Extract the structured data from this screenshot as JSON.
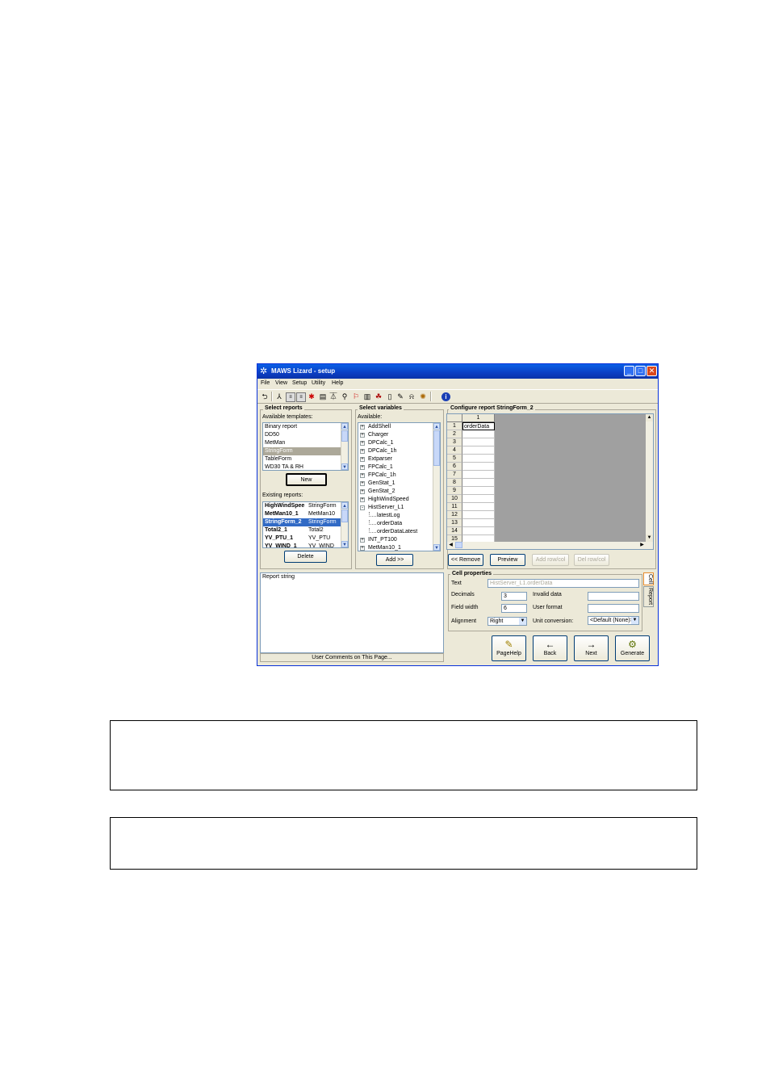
{
  "window": {
    "title": "MAWS Lizard - setup",
    "controls": [
      "minimize",
      "maximize",
      "close"
    ]
  },
  "menu": [
    "File",
    "View",
    "Setup",
    "Utility",
    "Help"
  ],
  "toolbar_icons": [
    "undo-icon",
    "network-icon",
    "sei-icon",
    "sei2-icon",
    "sensor-icon",
    "module-icon",
    "tower-icon",
    "wind-icon",
    "flag-icon",
    "log-icon",
    "chart-icon",
    "page-icon",
    "tools-icon",
    "bell-icon",
    "gear-icon",
    "info-icon"
  ],
  "select_reports": {
    "title": "Select reports",
    "available_label": "Available templates:",
    "templates": [
      "Binary report",
      "DD50",
      "MetMan",
      "StringForm",
      "TableForm",
      "WD30 TA & RH"
    ],
    "selected_template": 3,
    "new_button": "New",
    "existing_label": "Existing reports:",
    "existing": [
      {
        "name": "HighWindSpee",
        "type": "StringForm"
      },
      {
        "name": "MetMan10_1",
        "type": "MetMan10"
      },
      {
        "name": "StringForm_2",
        "type": "StringForm"
      },
      {
        "name": "Total2_1",
        "type": "Total2"
      },
      {
        "name": "YV_PTU_1",
        "type": "YV_PTU"
      },
      {
        "name": "YV_WIND_1",
        "type": "YV_WIND"
      }
    ],
    "selected_existing": 2,
    "delete_button": "Delete"
  },
  "select_variables": {
    "title": "Select variables",
    "available_label": "Available:",
    "tree": [
      {
        "label": "AddShell",
        "level": 0,
        "node": "+"
      },
      {
        "label": "Charger",
        "level": 0,
        "node": "+"
      },
      {
        "label": "DPCalc_1",
        "level": 0,
        "node": "+"
      },
      {
        "label": "DPCalc_1h",
        "level": 0,
        "node": "+"
      },
      {
        "label": "Extparser",
        "level": 0,
        "node": "+"
      },
      {
        "label": "FPCalc_1",
        "level": 0,
        "node": "+"
      },
      {
        "label": "FPCalc_1h",
        "level": 0,
        "node": "+"
      },
      {
        "label": "GenStat_1",
        "level": 0,
        "node": "+"
      },
      {
        "label": "GenStat_2",
        "level": 0,
        "node": "+"
      },
      {
        "label": "HighWindSpeed",
        "level": 0,
        "node": "+"
      },
      {
        "label": "HistServer_L1",
        "level": 0,
        "node": "-"
      },
      {
        "label": "latestLog",
        "level": 1,
        "node": ""
      },
      {
        "label": "orderData",
        "level": 1,
        "node": ""
      },
      {
        "label": "orderDataLatest",
        "level": 1,
        "node": ""
      },
      {
        "label": "INT_PT100",
        "level": 0,
        "node": "+"
      },
      {
        "label": "MetMan10_1",
        "level": 0,
        "node": "+"
      }
    ],
    "add_button": "Add >>"
  },
  "configure": {
    "title": "Configure report StringForm_2",
    "col_header": "1",
    "rows": [
      "1",
      "2",
      "3",
      "4",
      "5",
      "6",
      "7",
      "8",
      "9",
      "10",
      "11",
      "12",
      "13",
      "14",
      "15"
    ],
    "cells": [
      "orderData",
      "",
      "",
      "",
      "",
      "",
      "",
      "",
      "",
      "",
      "",
      "",
      "",
      "",
      ""
    ],
    "remove_button": "<< Remove",
    "preview_button": "Preview",
    "add_rowcol_button": "Add row/col",
    "del_rowcol_button": "Del row/col"
  },
  "cell_properties": {
    "title": "Cell properties",
    "text_label": "Text",
    "text_value": "HistServer_L1.orderData",
    "decimals_label": "Decimals",
    "decimals_value": "3",
    "invalid_label": "Invalid data",
    "invalid_value": "",
    "field_width_label": "Field width",
    "field_width_value": "6",
    "user_format_label": "User format",
    "user_format_value": "",
    "alignment_label": "Alignment",
    "alignment_value": "Right",
    "unit_label": "Unit conversion:",
    "unit_value": "<Default (None)>",
    "tab_cell": "Cell",
    "tab_report": "Report"
  },
  "comments": {
    "text": "Report string",
    "button": "User Comments on This Page..."
  },
  "nav": {
    "pagehelp": "PageHelp",
    "back": "Back",
    "next": "Next",
    "generate": "Generate"
  }
}
